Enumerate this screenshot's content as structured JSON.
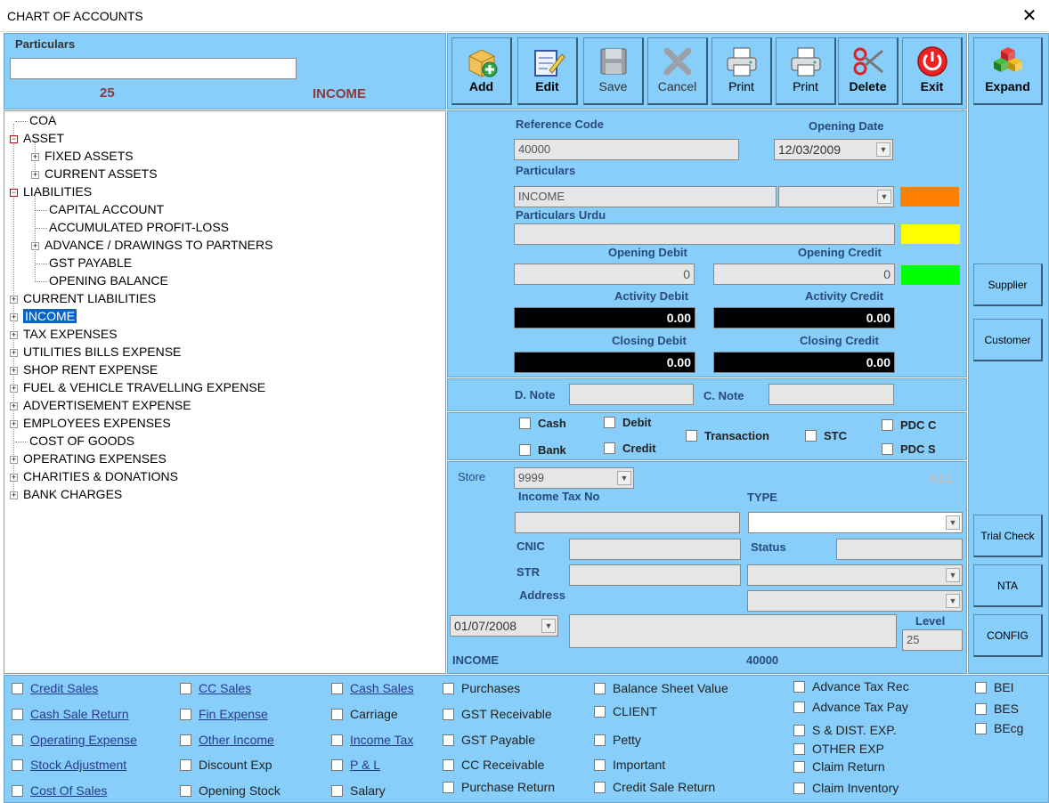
{
  "window": {
    "title": "CHART OF ACCOUNTS",
    "close": "✕"
  },
  "search": {
    "label": "Particulars",
    "value": "",
    "count": "25",
    "selected": "INCOME"
  },
  "toolbar": [
    {
      "name": "add",
      "label": "Add"
    },
    {
      "name": "edit",
      "label": "Edit"
    },
    {
      "name": "save",
      "label": "Save"
    },
    {
      "name": "cancel",
      "label": "Cancel"
    },
    {
      "name": "print1",
      "label": "Print"
    },
    {
      "name": "print2",
      "label": "Print"
    },
    {
      "name": "delete",
      "label": "Delete"
    },
    {
      "name": "exit",
      "label": "Exit"
    }
  ],
  "side": {
    "expand": "Expand",
    "supplier": "Supplier",
    "customer": "Customer",
    "trial_check": "Trial Check",
    "nta": "NTA",
    "config": "CONFIG"
  },
  "tree": [
    {
      "label": "COA"
    },
    {
      "label": "ASSET"
    },
    {
      "label": "FIXED ASSETS"
    },
    {
      "label": "CURRENT ASSETS"
    },
    {
      "label": "LIABILITIES"
    },
    {
      "label": "CAPITAL ACCOUNT"
    },
    {
      "label": "ACCUMULATED PROFIT-LOSS"
    },
    {
      "label": "ADVANCE / DRAWINGS TO PARTNERS"
    },
    {
      "label": "GST PAYABLE"
    },
    {
      "label": "OPENING BALANCE"
    },
    {
      "label": "CURRENT LIABILITIES"
    },
    {
      "label": "INCOME"
    },
    {
      "label": "TAX EXPENSES"
    },
    {
      "label": "UTILITIES BILLS EXPENSE"
    },
    {
      "label": "SHOP RENT  EXPENSE"
    },
    {
      "label": "FUEL & VEHICLE TRAVELLING EXPENSE"
    },
    {
      "label": "ADVERTISEMENT EXPENSE"
    },
    {
      "label": "EMPLOYEES EXPENSES"
    },
    {
      "label": "COST OF GOODS"
    },
    {
      "label": "OPERATING EXPENSES"
    },
    {
      "label": "CHARITIES & DONATIONS"
    },
    {
      "label": "BANK CHARGES"
    }
  ],
  "form": {
    "ref_code_label": "Reference Code",
    "ref_code": "40000",
    "opening_date_label": "Opening Date",
    "opening_date": "12/03/2009",
    "particulars_label": "Particulars",
    "particulars": "INCOME",
    "particulars_urdu_label": "Particulars Urdu",
    "particulars_urdu": "",
    "opening_debit_label": "Opening Debit",
    "opening_debit": "0",
    "opening_credit_label": "Opening Credit",
    "opening_credit": "0",
    "activity_debit_label": "Activity Debit",
    "activity_debit": "0.00",
    "activity_credit_label": "Activity Credit",
    "activity_credit": "0.00",
    "closing_debit_label": "Closing Debit",
    "closing_debit": "0.00",
    "closing_credit_label": "Closing Credit",
    "closing_credit": "0.00",
    "colors": {
      "c1": "#FF8000",
      "c2": "#FFFF00",
      "c3": "#00FF00"
    }
  },
  "notes": {
    "dnote_label": "D. Note",
    "cnote_label": "C. Note"
  },
  "flags": {
    "cash": "Cash",
    "bank": "Bank",
    "debit": "Debit",
    "credit": "Credit",
    "transaction": "Transaction",
    "stc": "STC",
    "pdcc": "PDC C",
    "pdcs": "PDC S"
  },
  "store": {
    "store_label": "Store",
    "store": "9999",
    "all": "ALL",
    "income_tax_label": "Income Tax No",
    "type_label": "TYPE",
    "cnic_label": "CNIC",
    "status_label": "Status",
    "str_label": "STR",
    "address_label": "Address",
    "date": "01/07/2008",
    "level_label": "Level",
    "level": "25",
    "footer_name": "INCOME",
    "footer_code": "40000"
  },
  "bottom": {
    "col1": [
      "Credit Sales",
      "Cash Sale Return",
      "Operating Expense",
      "Stock Adjustment",
      "Cost Of Sales"
    ],
    "col2": [
      "CC Sales",
      "Fin Expense",
      "Other Income",
      "Discount Exp",
      "Opening Stock"
    ],
    "col3": [
      "Cash Sales",
      "Carriage",
      "Income Tax",
      "P & L",
      "Salary"
    ],
    "col4": [
      "Purchases",
      "GST Receivable",
      "GST Payable",
      "CC Receivable",
      "Purchase Return"
    ],
    "col5": [
      "Balance Sheet Value",
      "CLIENT",
      "Petty",
      "Important",
      "Credit Sale Return"
    ],
    "col6": [
      "Advance Tax Rec",
      "Advance Tax Pay",
      "S & DIST. EXP.",
      "OTHER EXP",
      "Claim Return",
      "Claim Inventory"
    ],
    "col7": [
      "BEI",
      "BES",
      "BEcg"
    ]
  }
}
